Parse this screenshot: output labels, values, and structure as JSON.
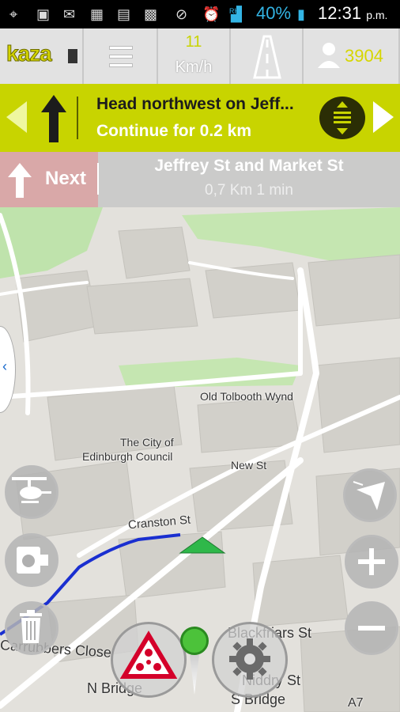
{
  "status": {
    "battery_pct": "40%",
    "time": "12:31",
    "ampm": "p.m.",
    "carrier_tag": "RH"
  },
  "appbar": {
    "logo": "kaza",
    "speed_value": "11",
    "speed_unit": "Km/h",
    "user_value": "3904"
  },
  "instruction": {
    "main": "Head northwest on Jeff...",
    "sub": "Continue for 0.2 km"
  },
  "next": {
    "label": "Next",
    "street": "Jeffrey St and Market St",
    "distance": "0,7 Km   1 min"
  },
  "map": {
    "labels": {
      "old_tolbooth": "Old Tolbooth Wynd",
      "city_council_1": "The City of",
      "city_council_2": "Edinburgh Council",
      "new_st": "New St",
      "cranston": "Cranston St",
      "blackfriars": "Blackfriars St",
      "carrubbers": "Carrubbers Close",
      "n_bridge": "N Bridge",
      "niddry": "Niddry St",
      "s_bridge": "S Bridge",
      "a7": "A7"
    }
  },
  "colors": {
    "accent": "#c8d400",
    "route": "#1a2fd0",
    "position_marker": "#2fb84a"
  }
}
